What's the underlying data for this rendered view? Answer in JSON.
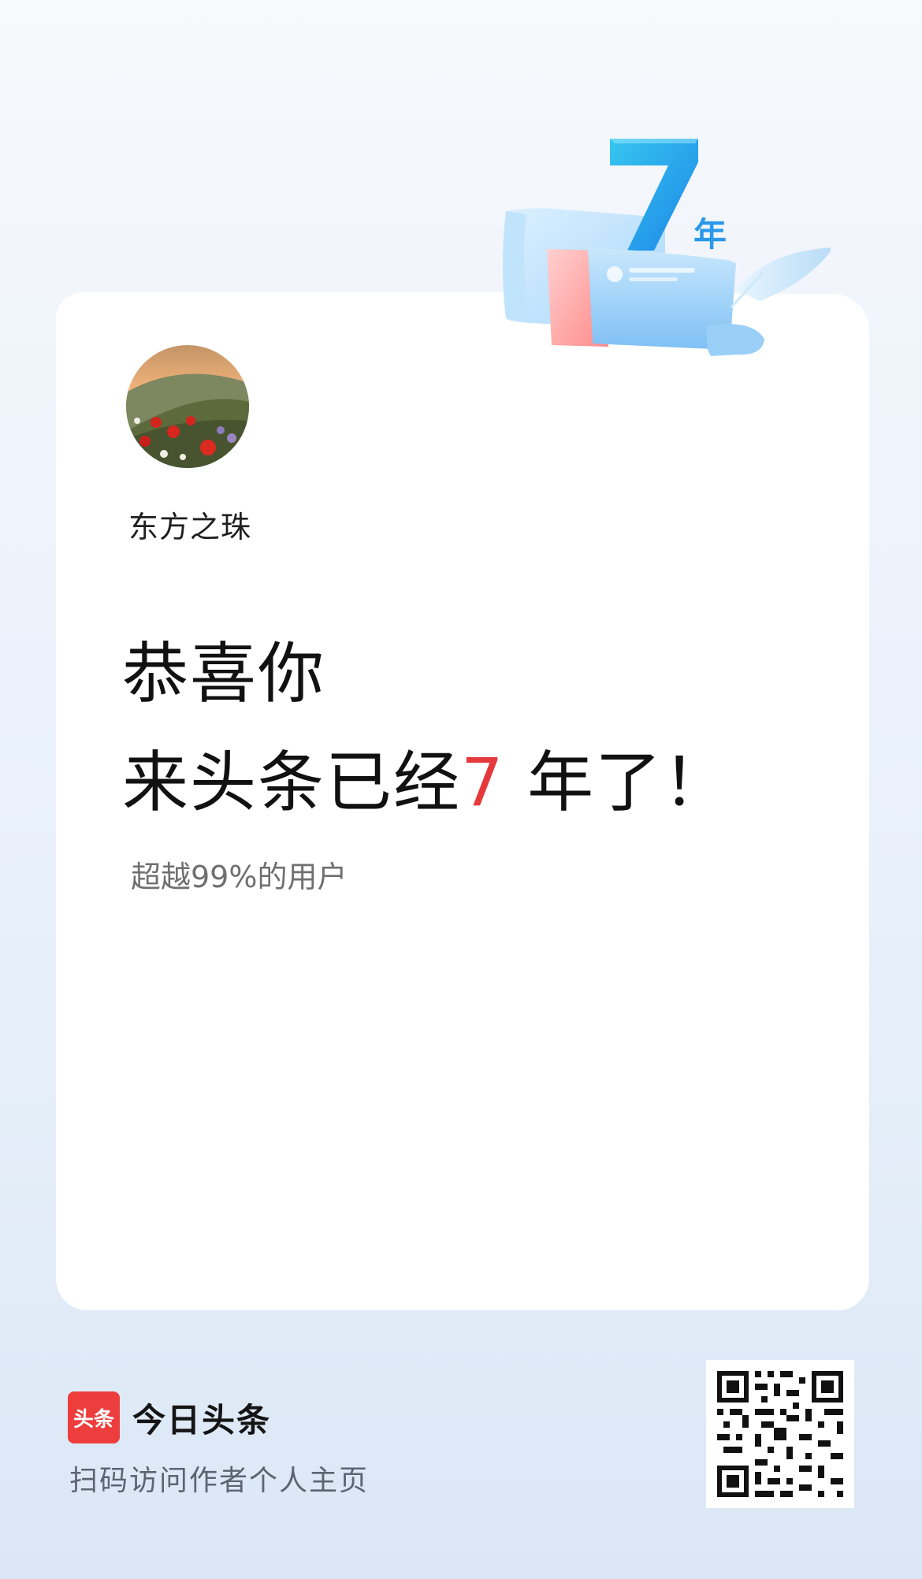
{
  "badge": {
    "number": "7",
    "unit": "年"
  },
  "profile": {
    "username": "东方之珠"
  },
  "headline": {
    "line1": "恭喜你",
    "line2_prefix": "来头条已经",
    "years": "7",
    "line2_suffix": " 年了！"
  },
  "rank_text": "超越99%的用户",
  "footer": {
    "logo_text": "头条",
    "brand_name": "今日头条",
    "scan_hint": "扫码访问作者个人主页"
  },
  "colors": {
    "accent": "#e5393c",
    "brand_red": "#ee3d3d",
    "badge_blue": "#2aa5f0"
  },
  "icons": [
    "anniversary-badge-icon",
    "qr-code-icon",
    "toutiao-logo-icon"
  ]
}
